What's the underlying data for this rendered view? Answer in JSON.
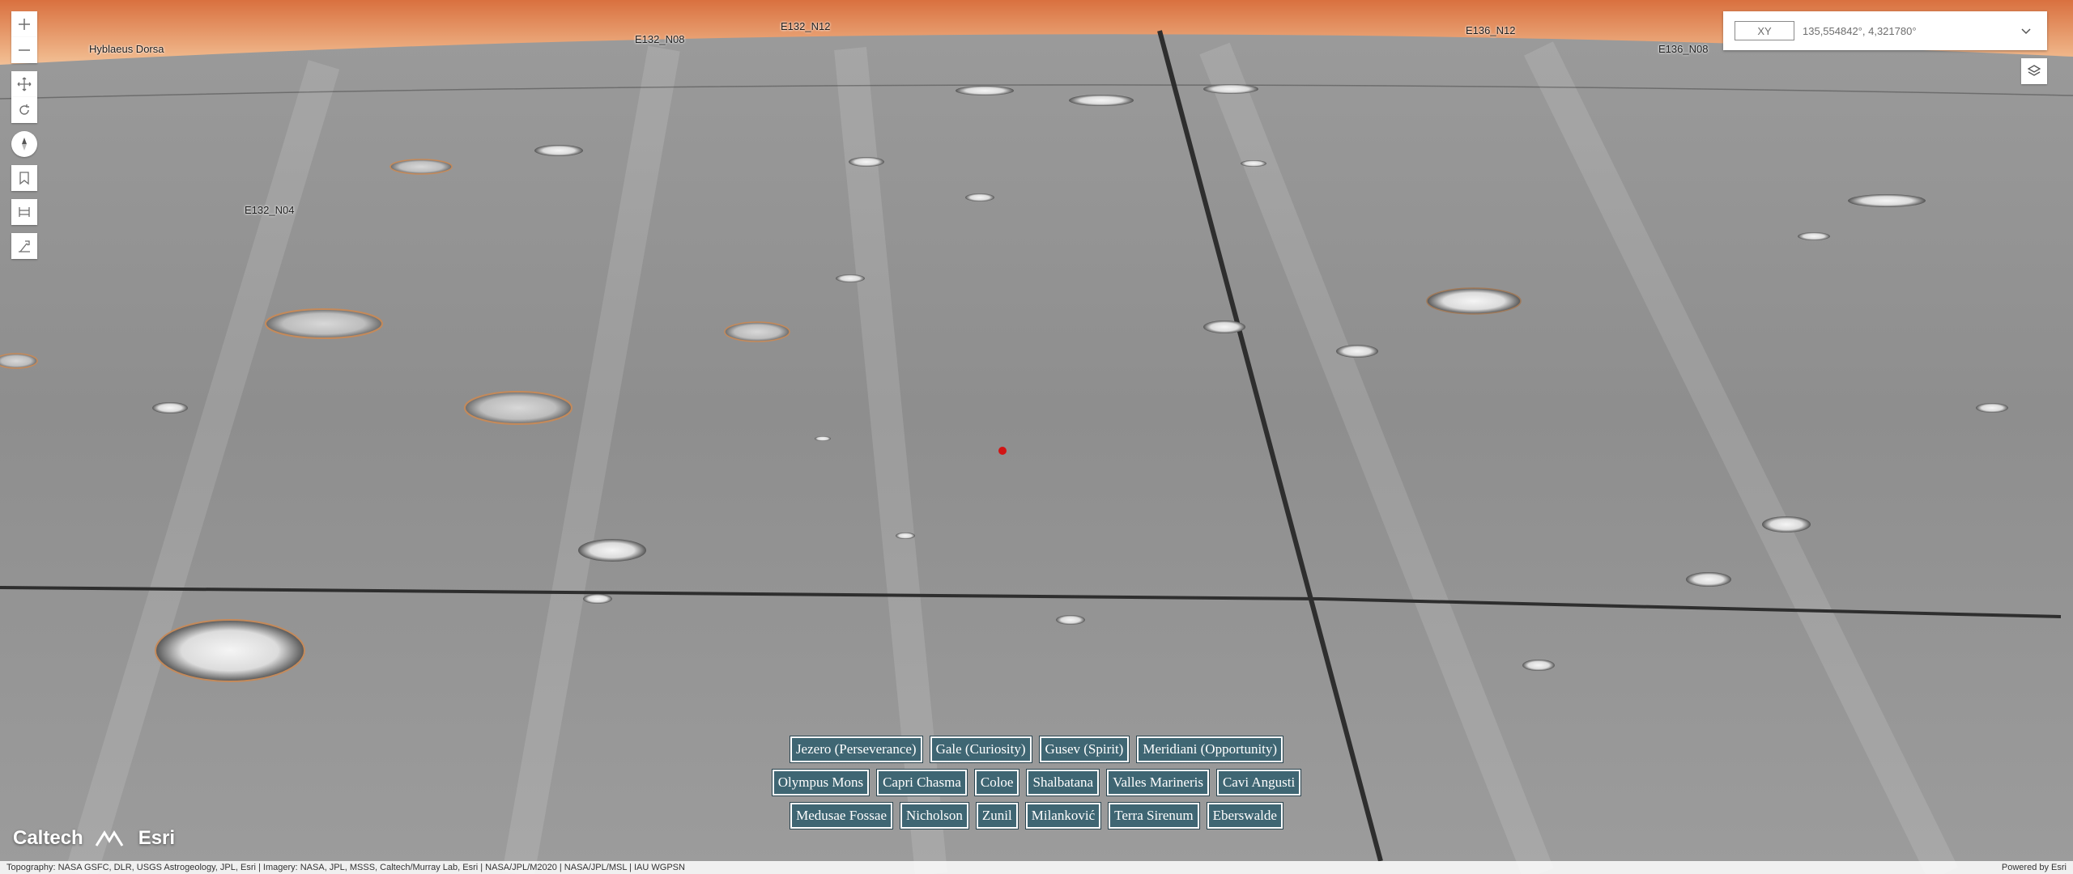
{
  "toolbar": {
    "zoom_in_icon": "plus-icon",
    "zoom_out_icon": "minus-icon",
    "pan_icon": "move-icon",
    "rotate_icon": "rotate-icon",
    "compass_icon": "compass-icon",
    "bookmark_icon": "bookmark-icon",
    "slice_icon": "slice-icon",
    "measure_icon": "measure-icon"
  },
  "coordinate_widget": {
    "mode": "XY",
    "value": "135,554842°, 4,321780°"
  },
  "map_labels": [
    "Hyblaeus Dorsa",
    "E132_N08",
    "E132_N12",
    "E136_N12",
    "E136_N08",
    "E132_N04"
  ],
  "sites": {
    "row1": [
      "Jezero (Perseverance)",
      "Gale (Curiosity)",
      "Gusev (Spirit)",
      "Meridiani (Opportunity)"
    ],
    "row2": [
      "Olympus Mons",
      "Capri Chasma",
      "Coloe",
      "Shalbatana",
      "Valles Marineris",
      "Cavi Angusti"
    ],
    "row3": [
      "Medusae Fossae",
      "Nicholson",
      "Zunil",
      "Milanković",
      "Terra Sirenum",
      "Eberswalde"
    ]
  },
  "logos": {
    "caltech": "Caltech",
    "esri": "Esri"
  },
  "attribution": "Topography: NASA GSFC, DLR, USGS Astrogeology, JPL, Esri | Imagery: NASA, JPL, MSSS, Caltech/Murray Lab, Esri | NASA/JPL/M2020 | NASA/JPL/MSL | IAU WGPSN",
  "powered_by": "Powered by Esri",
  "colors": {
    "sky_top": "#e07a45",
    "sky_horizon": "#f4d8b8",
    "terrain": "#8f8f8f",
    "site_button": "#3f6673",
    "marker": "#d21414"
  }
}
